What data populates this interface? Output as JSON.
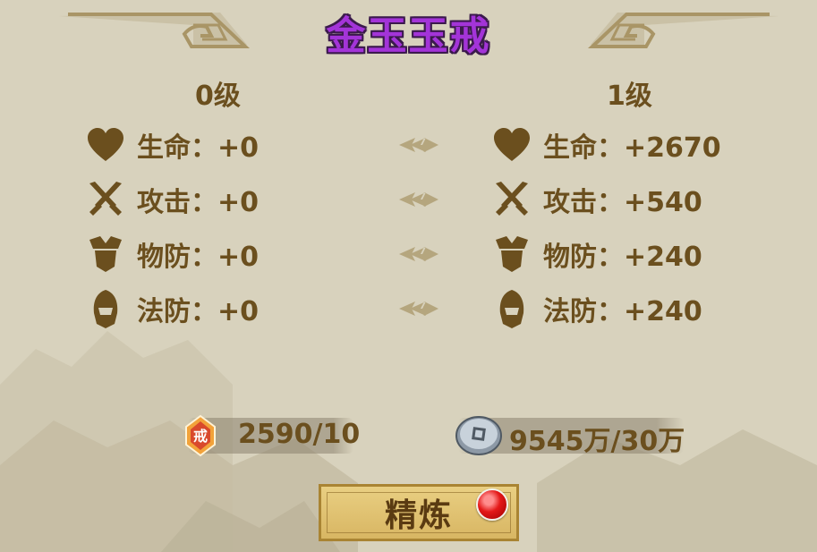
{
  "title": "金玉玉戒",
  "levels": {
    "current": "0级",
    "next": "1级"
  },
  "stats_current": [
    {
      "icon": "heart-icon",
      "label": "生命：+0"
    },
    {
      "icon": "crossed-swords-icon",
      "label": "攻击：+0"
    },
    {
      "icon": "armor-icon",
      "label": "物防：+0"
    },
    {
      "icon": "helmet-icon",
      "label": "法防：+0"
    }
  ],
  "stats_next": [
    {
      "icon": "heart-icon",
      "label": "生命：+2670"
    },
    {
      "icon": "crossed-swords-icon",
      "label": "攻击：+540"
    },
    {
      "icon": "armor-icon",
      "label": "物防：+240"
    },
    {
      "icon": "helmet-icon",
      "label": "法防：+240"
    }
  ],
  "resources": {
    "ring_token": {
      "icon": "ring-token-icon",
      "badge": "戒",
      "value": "2590/10"
    },
    "silver": {
      "icon": "silver-coin-icon",
      "value": "9545万/30万"
    }
  },
  "refine_button": {
    "label": "精炼",
    "has_notification": true
  },
  "colors": {
    "title": "#a334d8",
    "text": "#6b4f1e",
    "background": "#d8d2bd",
    "button": "#dcbc6a",
    "notification": "#e41818"
  }
}
